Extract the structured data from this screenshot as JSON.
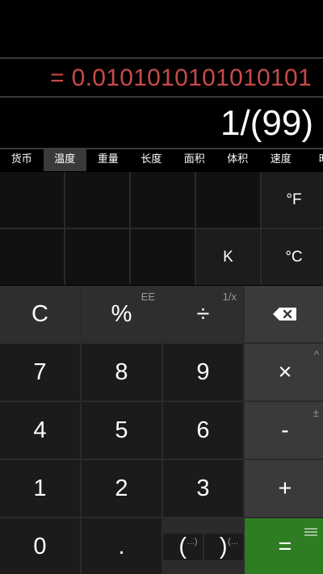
{
  "display": {
    "result": "= 0.0101010101010101",
    "expression": "1/(99)"
  },
  "tabs": [
    {
      "label": "货币"
    },
    {
      "label": "温度",
      "active": true
    },
    {
      "label": "重量"
    },
    {
      "label": "长度"
    },
    {
      "label": "面积"
    },
    {
      "label": "体积"
    },
    {
      "label": "速度"
    },
    {
      "label": "时"
    }
  ],
  "units": {
    "fahrenheit": "°F",
    "kelvin": "K",
    "celsius": "°C"
  },
  "keys": {
    "clear": "C",
    "percent": "%",
    "percent_alt": "EE",
    "divide": "÷",
    "divide_alt": "1/x",
    "multiply": "×",
    "multiply_alt": "^",
    "minus": "-",
    "minus_alt": "±",
    "plus": "+",
    "equals": "=",
    "seven": "7",
    "eight": "8",
    "nine": "9",
    "four": "4",
    "five": "5",
    "six": "6",
    "one": "1",
    "two": "2",
    "three": "3",
    "zero": "0",
    "dot": ".",
    "paren_open": "(",
    "paren_open_alt": "...)",
    "paren_close": ")",
    "paren_close_alt": "(..."
  },
  "colors": {
    "result_text": "#c94a4a",
    "equals_key": "#2e7d22"
  }
}
